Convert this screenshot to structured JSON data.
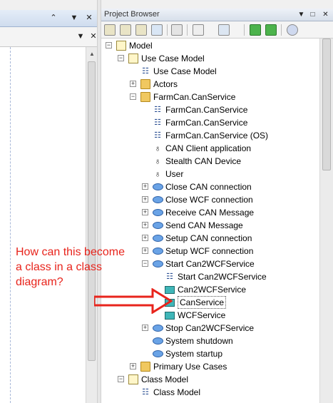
{
  "left_pane": {
    "titlebar_icons": [
      "chevron-up-icon",
      "dropdown-icon",
      "close-icon"
    ],
    "toolbar_icons": [
      "dropdown-icon",
      "close-icon"
    ]
  },
  "project_browser": {
    "title": "Project Browser",
    "title_icons": [
      "dropdown-icon",
      "pin-icon",
      "close-icon"
    ],
    "toolbar_icons": [
      "new-package-icon",
      "new-view-icon",
      "new-diagram-icon",
      "new-element-icon",
      "find-icon",
      "edit-icon",
      "view-options-icon",
      "move-up-icon",
      "move-down-icon",
      "help-icon"
    ],
    "tree": [
      {
        "label": "Model",
        "type": "model",
        "depth": 0,
        "expander": "minus"
      },
      {
        "label": "Use Case Model",
        "type": "package",
        "depth": 1,
        "expander": "minus"
      },
      {
        "label": "Use Case Model",
        "type": "diagram",
        "depth": 2,
        "expander": ""
      },
      {
        "label": "Actors",
        "type": "folder",
        "depth": 2,
        "expander": "plus"
      },
      {
        "label": "FarmCan.CanService",
        "type": "folder",
        "depth": 2,
        "expander": "minus"
      },
      {
        "label": "FarmCan.CanService",
        "type": "diagram",
        "depth": 3,
        "expander": ""
      },
      {
        "label": "FarmCan.CanService",
        "type": "diagram",
        "depth": 3,
        "expander": ""
      },
      {
        "label": "FarmCan.CanService (OS)",
        "type": "diagram",
        "depth": 3,
        "expander": ""
      },
      {
        "label": "CAN Client application",
        "type": "actor",
        "depth": 3,
        "expander": ""
      },
      {
        "label": "Stealth CAN Device",
        "type": "actor",
        "depth": 3,
        "expander": ""
      },
      {
        "label": "User",
        "type": "actor",
        "depth": 3,
        "expander": ""
      },
      {
        "label": "Close CAN connection",
        "type": "usecase",
        "depth": 3,
        "expander": "plus"
      },
      {
        "label": "Close WCF connection",
        "type": "usecase",
        "depth": 3,
        "expander": "plus"
      },
      {
        "label": "Receive CAN Message",
        "type": "usecase",
        "depth": 3,
        "expander": "plus"
      },
      {
        "label": "Send CAN Message",
        "type": "usecase",
        "depth": 3,
        "expander": "plus"
      },
      {
        "label": "Setup CAN connection",
        "type": "usecase",
        "depth": 3,
        "expander": "plus"
      },
      {
        "label": "Setup WCF connection",
        "type": "usecase",
        "depth": 3,
        "expander": "plus"
      },
      {
        "label": "Start Can2WCFService",
        "type": "usecase",
        "depth": 3,
        "expander": "minus"
      },
      {
        "label": "Start Can2WCFService",
        "type": "diagram",
        "depth": 4,
        "expander": ""
      },
      {
        "label": "Can2WCFService",
        "type": "class",
        "depth": 4,
        "expander": ""
      },
      {
        "label": "CanService",
        "type": "class",
        "depth": 4,
        "expander": "",
        "selected": true
      },
      {
        "label": "WCFService",
        "type": "class",
        "depth": 4,
        "expander": ""
      },
      {
        "label": "Stop Can2WCFService",
        "type": "usecase",
        "depth": 3,
        "expander": "plus"
      },
      {
        "label": "System shutdown",
        "type": "usecase",
        "depth": 3,
        "expander": ""
      },
      {
        "label": "System startup",
        "type": "usecase",
        "depth": 3,
        "expander": ""
      },
      {
        "label": "Primary Use Cases",
        "type": "folder",
        "depth": 2,
        "expander": "plus"
      },
      {
        "label": "Class Model",
        "type": "package",
        "depth": 1,
        "expander": "minus"
      },
      {
        "label": "Class Model",
        "type": "diagram",
        "depth": 2,
        "expander": ""
      }
    ]
  },
  "annotation": {
    "text": "How can this become a class in a class diagram?",
    "color": "#e8241c"
  }
}
